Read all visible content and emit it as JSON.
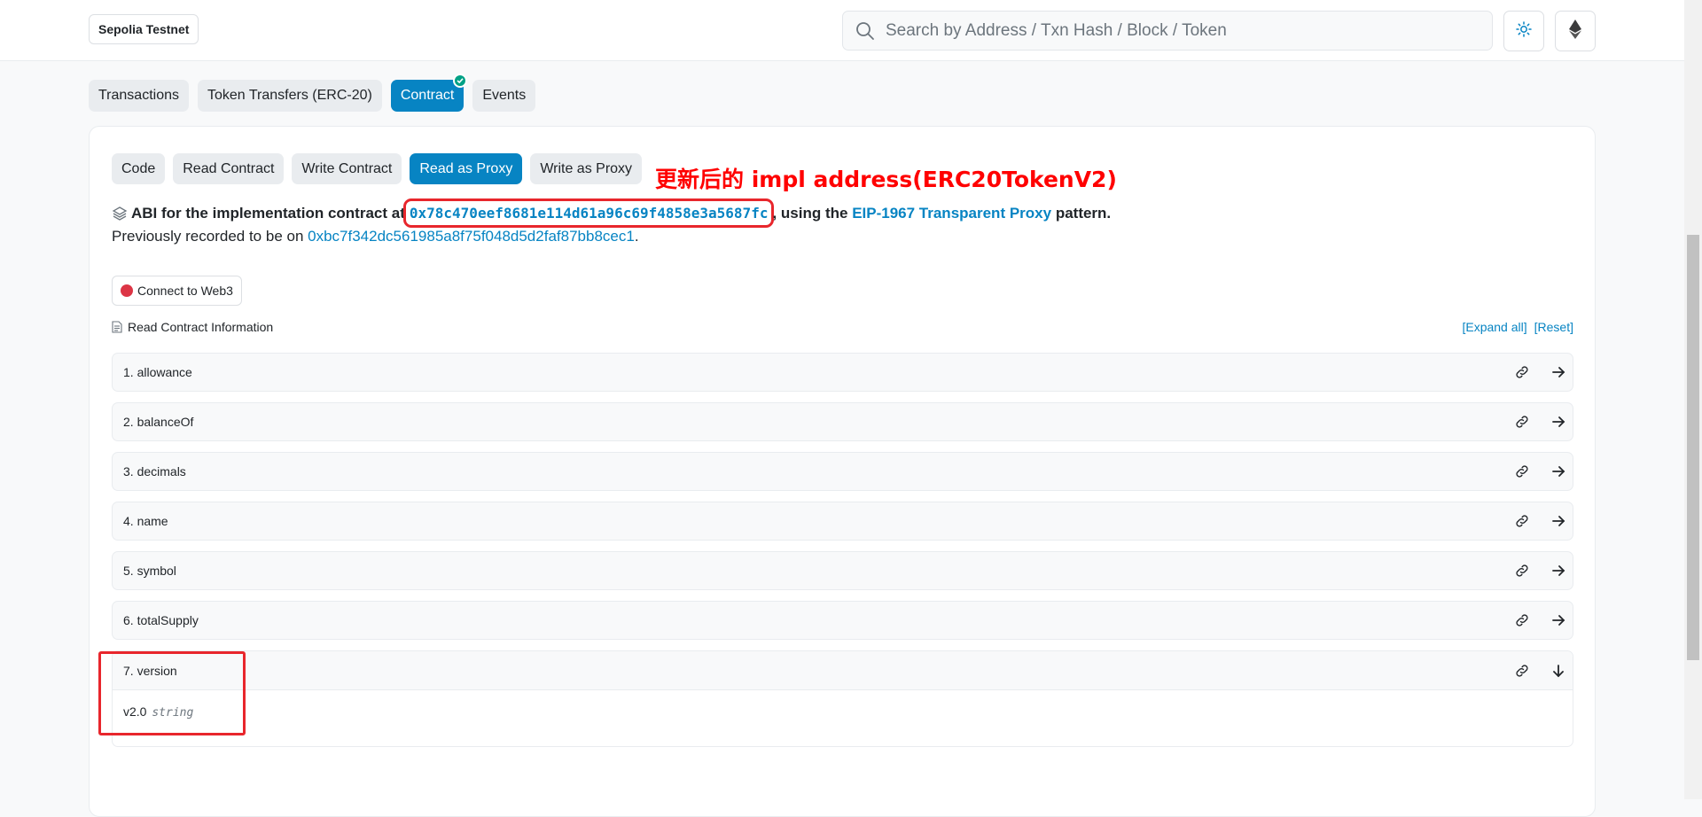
{
  "header": {
    "network": "Sepolia Testnet",
    "search_placeholder": "Search by Address / Txn Hash / Block / Token"
  },
  "main_tabs": [
    {
      "label": "Transactions",
      "active": false
    },
    {
      "label": "Token Transfers (ERC-20)",
      "active": false
    },
    {
      "label": "Contract",
      "active": true,
      "verified": true
    },
    {
      "label": "Events",
      "active": false
    }
  ],
  "sub_tabs": [
    {
      "label": "Code",
      "active": false
    },
    {
      "label": "Read Contract",
      "active": false
    },
    {
      "label": "Write Contract",
      "active": false
    },
    {
      "label": "Read as Proxy",
      "active": true
    },
    {
      "label": "Write as Proxy",
      "active": false
    }
  ],
  "annotation": "更新后的 impl address(ERC20TokenV2)",
  "abi": {
    "prefix": "ABI for the implementation contract at",
    "impl_address": "0x78c470eef8681e114d61a96c69f4858e3a5687fc",
    "middle": ", using the",
    "pattern_link": "EIP-1967 Transparent Proxy",
    "suffix": "pattern.",
    "prev_prefix": "Previously recorded to be on",
    "prev_address": "0xbc7f342dc561985a8f75f048d5d2faf87bb8cec1",
    "prev_suffix": "."
  },
  "connect_label": "Connect to Web3",
  "read_info": {
    "label": "Read Contract Information",
    "expand_all": "[Expand all]",
    "reset": "[Reset]"
  },
  "functions": [
    {
      "label": "1. allowance"
    },
    {
      "label": "2. balanceOf"
    },
    {
      "label": "3. decimals"
    },
    {
      "label": "4. name"
    },
    {
      "label": "5. symbol"
    },
    {
      "label": "6. totalSupply"
    },
    {
      "label": "7. version",
      "expanded": true,
      "result_value": "v2.0",
      "result_type": "string"
    }
  ],
  "colors": {
    "accent": "#0784c3",
    "annotation_red": "#ff0000",
    "verified_green": "#00a186",
    "disconnected_red": "#dc3545"
  },
  "icons": {
    "search": "search-icon",
    "theme": "sun-icon",
    "network": "ethereum-icon",
    "copy_link": "link-icon",
    "open": "arrow-right-icon",
    "expanded": "arrow-down-icon"
  }
}
